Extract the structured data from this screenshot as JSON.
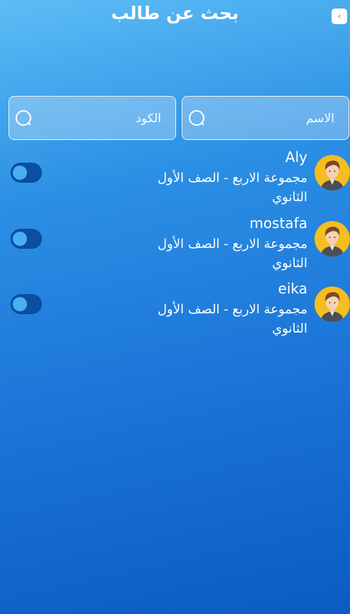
{
  "header": {
    "title": "بحث عن طالب",
    "back_icon": "chevron-left-icon"
  },
  "search": {
    "name_placeholder": "الاسم",
    "code_placeholder": "الكود",
    "icon": "search-icon"
  },
  "students": [
    {
      "name": "Aly",
      "group": "مجموعة الاربع - الصف الأول الثانوي",
      "active": false
    },
    {
      "name": "mostafa",
      "group": "مجموعة الاربع - الصف الأول الثانوي",
      "active": false
    },
    {
      "name": "eika",
      "group": "مجموعة الاربع - الصف الأول الثانوي",
      "active": false
    }
  ],
  "colors": {
    "bg_top": "#5cbdf5",
    "bg_bottom": "#0a5cc2",
    "toggle_track": "#0b4ea3",
    "toggle_knob": "#48aff2",
    "avatar_bg": "#f5bd1f"
  }
}
